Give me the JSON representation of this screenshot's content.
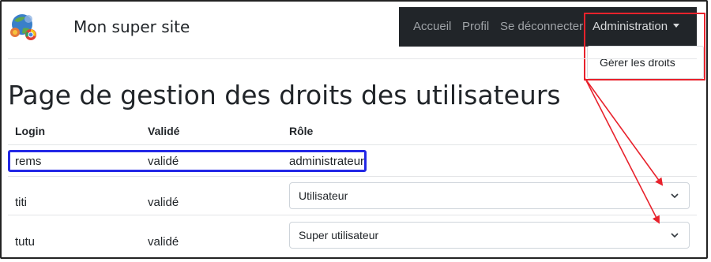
{
  "header": {
    "site_title": "Mon super site",
    "nav": [
      {
        "label": "Accueil"
      },
      {
        "label": "Profil"
      },
      {
        "label": "Se déconnecter"
      },
      {
        "label": "Administration"
      }
    ],
    "dropdown": {
      "items": [
        {
          "label": "Gérer les droits"
        }
      ]
    }
  },
  "page": {
    "title": "Page de gestion des droits des utilisateurs"
  },
  "table": {
    "headers": [
      "Login",
      "Validé",
      "Rôle"
    ],
    "rows": [
      {
        "login": "rems",
        "valide": "validé",
        "role": "administrateur"
      },
      {
        "login": "titi",
        "valide": "validé",
        "role": "Utilisateur"
      },
      {
        "login": "tutu",
        "valide": "validé",
        "role": "Super utilisateur"
      }
    ]
  },
  "annotations": {
    "highlight_red": "#e8222c",
    "highlight_blue": "#2328e6",
    "navbar_bg": "#212529"
  },
  "icons": [
    "browser-globe-logo-icon",
    "chevron-down-icon"
  ]
}
